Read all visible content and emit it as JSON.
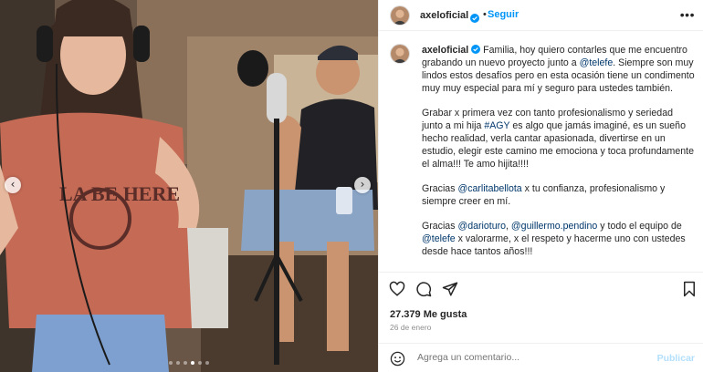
{
  "colors": {
    "accent": "#0095f6",
    "link": "#00376b",
    "muted": "#8e8e8e",
    "verified": "#0095f6"
  },
  "header": {
    "username": "axeloficial",
    "separator": "•",
    "follow_label": "Seguir",
    "more_icon": "more-horizontal-icon"
  },
  "media": {
    "prev_icon": "chevron-left-icon",
    "next_icon": "chevron-right-icon",
    "shirt_text": "LA BE HERE",
    "slides_count": 6,
    "active_slide_index": 3
  },
  "caption": {
    "username": "axeloficial",
    "p1_a": " Familia, hoy quiero contarles que me encuentro grabando un nuevo proyecto junto a ",
    "p1_tag": "@telefe",
    "p1_b": ". Siempre son muy lindos estos desafíos pero en esta ocasión tiene un condimento muy muy especial para mí y seguro para ustedes también.",
    "p2_a": "Grabar x primera vez con tanto profesionalismo y seriedad junto a mi hija ",
    "p2_tag": "#AGY",
    "p2_b": " es algo que jamás imaginé, es un sueño hecho realidad, verla cantar apasionada, divertirse en un estudio, elegir este camino me emociona y toca profundamente el alma!!! Te amo hijita!!!!",
    "p3_a": "Gracias ",
    "p3_tag": "@carlitabellota",
    "p3_b": " x tu confianza, profesionalismo y siempre creer en mí.",
    "p4_a": "Gracias ",
    "p4_tag1": "@darioturo",
    "p4_mid": ", ",
    "p4_tag2": "@guillermo.pendino",
    "p4_b": " y todo el equipo de ",
    "p4_tag3": "@telefe",
    "p4_c": " x valorarme, x el respeto y hacerme uno con ustedes desde hace tantos años!!!"
  },
  "actions": {
    "like_icon": "heart-icon",
    "comment_icon": "comment-icon",
    "share_icon": "share-icon",
    "save_icon": "bookmark-icon"
  },
  "stats": {
    "likes": "27.379 Me gusta",
    "date": "26 de enero"
  },
  "comment": {
    "emoji_icon": "emoji-icon",
    "placeholder": "Agrega un comentario...",
    "publish_label": "Publicar"
  }
}
